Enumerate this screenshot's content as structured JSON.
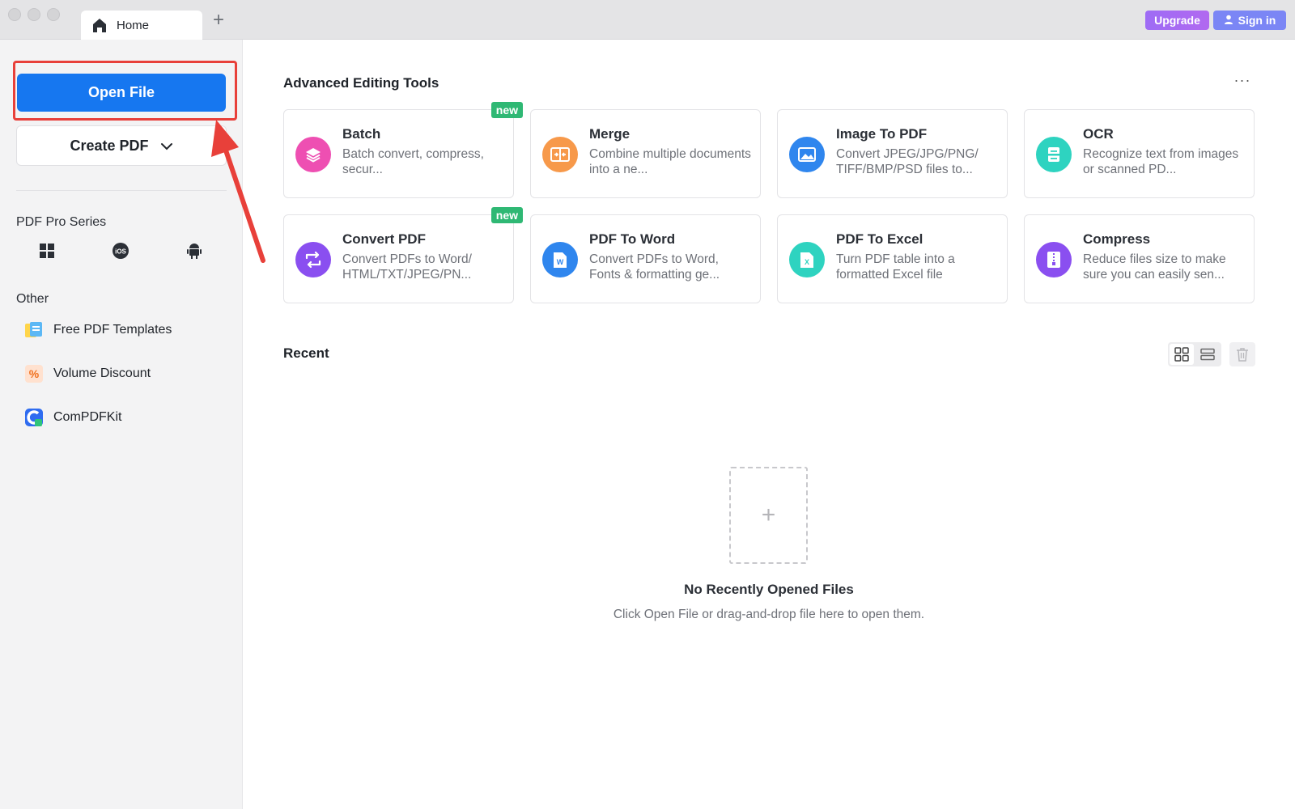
{
  "titlebar": {
    "tab_label": "Home",
    "new_tab_symbol": "+",
    "upgrade_label": "Upgrade",
    "signin_label": "Sign in"
  },
  "sidebar": {
    "open_file_label": "Open File",
    "create_pdf_label": "Create PDF",
    "pro_series_title": "PDF Pro Series",
    "platforms": [
      "windows-icon",
      "ios-icon",
      "android-icon"
    ],
    "ios_text": "iOS",
    "other_title": "Other",
    "other_items": [
      {
        "label": "Free PDF Templates",
        "icon": "templates-icon"
      },
      {
        "label": "Volume Discount",
        "icon": "percent-icon"
      },
      {
        "label": "ComPDFKit",
        "icon": "compdfkit-logo-icon"
      }
    ]
  },
  "main": {
    "section_title": "Advanced Editing Tools",
    "more_symbol": "···",
    "tools": [
      {
        "title": "Batch",
        "desc": "Batch convert, compress, secur...",
        "badge": "new",
        "color": "#ee4fb2"
      },
      {
        "title": "Merge",
        "desc": "Combine multiple documents into a ne...",
        "badge": "",
        "color": "#f7994a"
      },
      {
        "title": "Image To PDF",
        "desc": "Convert JPEG/JPG/PNG/ TIFF/BMP/PSD files to...",
        "badge": "",
        "color": "#2f86ee"
      },
      {
        "title": "OCR",
        "desc": "Recognize text from images or scanned PD...",
        "badge": "",
        "color": "#2ed3c0"
      },
      {
        "title": "Convert PDF",
        "desc": "Convert PDFs to Word/ HTML/TXT/JPEG/PN...",
        "badge": "new",
        "color": "#8a4ff0"
      },
      {
        "title": "PDF To Word",
        "desc": "Convert PDFs to Word, Fonts & formatting ge...",
        "badge": "",
        "color": "#2f86ee"
      },
      {
        "title": "PDF To Excel",
        "desc": "Turn PDF table into a formatted Excel file",
        "badge": "",
        "color": "#2ed3c0"
      },
      {
        "title": "Compress",
        "desc": "Reduce files size to make sure you can easily sen...",
        "badge": "",
        "color": "#8a4ff0"
      }
    ],
    "recent_title": "Recent",
    "drop_symbol": "+",
    "empty_title": "No Recently Opened Files",
    "empty_desc": "Click Open File or drag-and-drop file here to open them."
  }
}
